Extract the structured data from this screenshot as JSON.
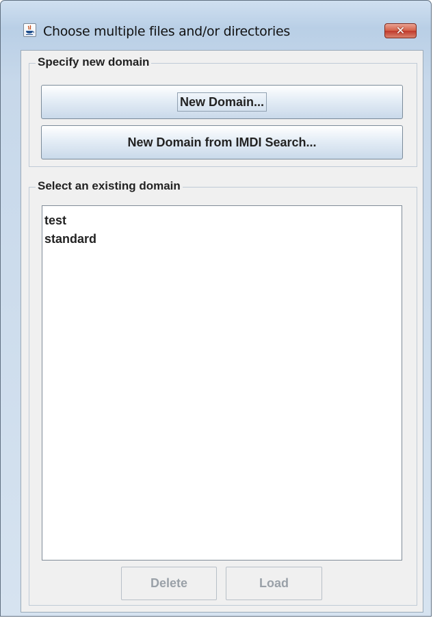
{
  "window": {
    "title": "Choose multiple files and/or directories",
    "close_label": "✕",
    "app_icon": "java-icon"
  },
  "new_domain_group": {
    "legend": "Specify new domain",
    "new_domain_button": "New Domain...",
    "imdi_search_button": "New Domain from IMDI Search..."
  },
  "existing_domain_group": {
    "legend": "Select an existing domain",
    "domains": [
      {
        "label": "test"
      },
      {
        "label": "standard"
      }
    ],
    "delete_button": "Delete",
    "load_button": "Load"
  },
  "colors": {
    "titlebar": "#c7d8ea",
    "close_button": "#c0392b",
    "dialog_background": "#f0f0f0"
  }
}
